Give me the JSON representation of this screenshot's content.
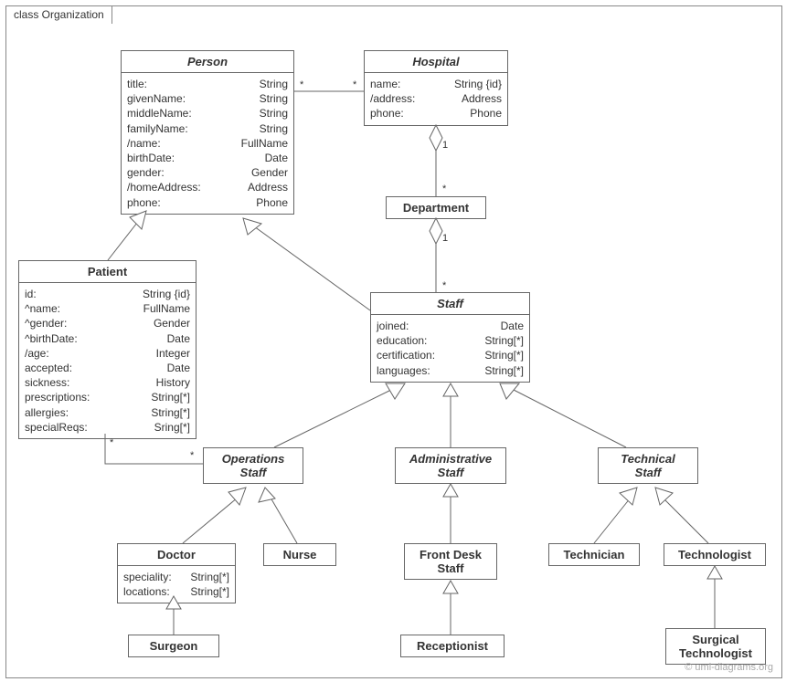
{
  "frame": {
    "title": "class Organization"
  },
  "copyright": "© uml-diagrams.org",
  "classes": {
    "person": {
      "name": "Person",
      "attrs": [
        {
          "n": "title:",
          "t": "String"
        },
        {
          "n": "givenName:",
          "t": "String"
        },
        {
          "n": "middleName:",
          "t": "String"
        },
        {
          "n": "familyName:",
          "t": "String"
        },
        {
          "n": "/name:",
          "t": "FullName"
        },
        {
          "n": "birthDate:",
          "t": "Date"
        },
        {
          "n": "gender:",
          "t": "Gender"
        },
        {
          "n": "/homeAddress:",
          "t": "Address"
        },
        {
          "n": "phone:",
          "t": "Phone"
        }
      ]
    },
    "hospital": {
      "name": "Hospital",
      "attrs": [
        {
          "n": "name:",
          "t": "String {id}"
        },
        {
          "n": "/address:",
          "t": "Address"
        },
        {
          "n": "phone:",
          "t": "Phone"
        }
      ]
    },
    "department": {
      "name": "Department"
    },
    "patient": {
      "name": "Patient",
      "attrs": [
        {
          "n": "id:",
          "t": "String {id}"
        },
        {
          "n": "^name:",
          "t": "FullName"
        },
        {
          "n": "^gender:",
          "t": "Gender"
        },
        {
          "n": "^birthDate:",
          "t": "Date"
        },
        {
          "n": "/age:",
          "t": "Integer"
        },
        {
          "n": "accepted:",
          "t": "Date"
        },
        {
          "n": "sickness:",
          "t": "History"
        },
        {
          "n": "prescriptions:",
          "t": "String[*]"
        },
        {
          "n": "allergies:",
          "t": "String[*]"
        },
        {
          "n": "specialReqs:",
          "t": "Sring[*]"
        }
      ]
    },
    "staff": {
      "name": "Staff",
      "attrs": [
        {
          "n": "joined:",
          "t": "Date"
        },
        {
          "n": "education:",
          "t": "String[*]"
        },
        {
          "n": "certification:",
          "t": "String[*]"
        },
        {
          "n": "languages:",
          "t": "String[*]"
        }
      ]
    },
    "opsStaff": {
      "name": "Operations\nStaff"
    },
    "adminStaff": {
      "name": "Administrative\nStaff"
    },
    "techStaff": {
      "name": "Technical\nStaff"
    },
    "doctor": {
      "name": "Doctor",
      "attrs": [
        {
          "n": "speciality:",
          "t": "String[*]"
        },
        {
          "n": "locations:",
          "t": "String[*]"
        }
      ]
    },
    "nurse": {
      "name": "Nurse"
    },
    "frontDesk": {
      "name": "Front Desk\nStaff"
    },
    "technician": {
      "name": "Technician"
    },
    "technologist": {
      "name": "Technologist"
    },
    "surgeon": {
      "name": "Surgeon"
    },
    "receptionist": {
      "name": "Receptionist"
    },
    "surgTech": {
      "name": "Surgical\nTechnologist"
    }
  },
  "mult": {
    "person_hosp_l": "*",
    "person_hosp_r": "*",
    "hosp_dept_1": "1",
    "hosp_dept_star": "*",
    "dept_staff_1": "1",
    "dept_staff_star": "*",
    "pat_ops_l": "*",
    "pat_ops_r": "*"
  }
}
